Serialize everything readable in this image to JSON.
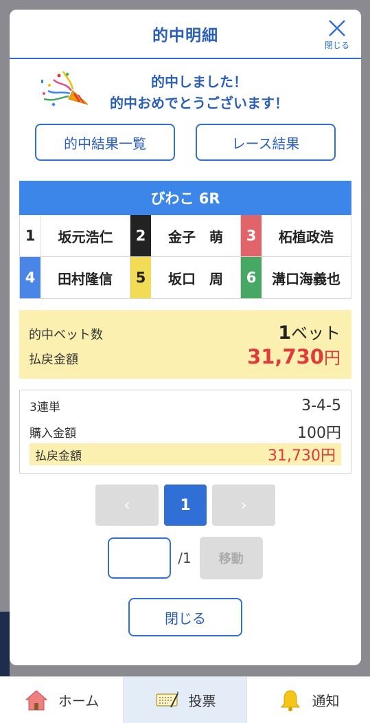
{
  "modal": {
    "title": "的中明細",
    "close_label": "閉じる"
  },
  "congrats": {
    "line1": "的中しました！",
    "line2": "的中おめでとうございます！"
  },
  "buttons": {
    "hit_list": "的中結果一覧",
    "race_result": "レース結果"
  },
  "race": {
    "title": "びわこ 6R",
    "racers": [
      {
        "num": "1",
        "name": "坂元浩仁"
      },
      {
        "num": "2",
        "name": "金子　萌"
      },
      {
        "num": "3",
        "name": "柘植政浩"
      },
      {
        "num": "4",
        "name": "田村隆信"
      },
      {
        "num": "5",
        "name": "坂口　周"
      },
      {
        "num": "6",
        "name": "溝口海義也"
      }
    ],
    "lane_colors": [
      "#ffffff",
      "#222222",
      "#e06469",
      "#4a86e8",
      "#f3dc55",
      "#46a862"
    ]
  },
  "summary": {
    "bet_count_label": "的中ベット数",
    "bet_count_value": "1",
    "bet_count_unit": "ベット",
    "payout_label": "払戻金額",
    "payout_value": "31,730",
    "payout_unit": "円"
  },
  "detail": {
    "bet_type": "3連単",
    "combination": "3-4-5",
    "purchase_label": "購入金額",
    "purchase_value": "100円",
    "payout_label": "払戻金額",
    "payout_value": "31,730円"
  },
  "pager": {
    "prev": "‹",
    "current": "1",
    "next": "›",
    "total": "/1",
    "move": "移動",
    "input_value": ""
  },
  "close_button": "閉じる",
  "tabbar": {
    "home": "ホーム",
    "vote": "投票",
    "notify": "通知"
  },
  "colors": {
    "accent": "#2f6fd6",
    "race_bar": "#3b86e8",
    "highlight": "#fbf0b0",
    "payout_red": "#e03a3a"
  }
}
